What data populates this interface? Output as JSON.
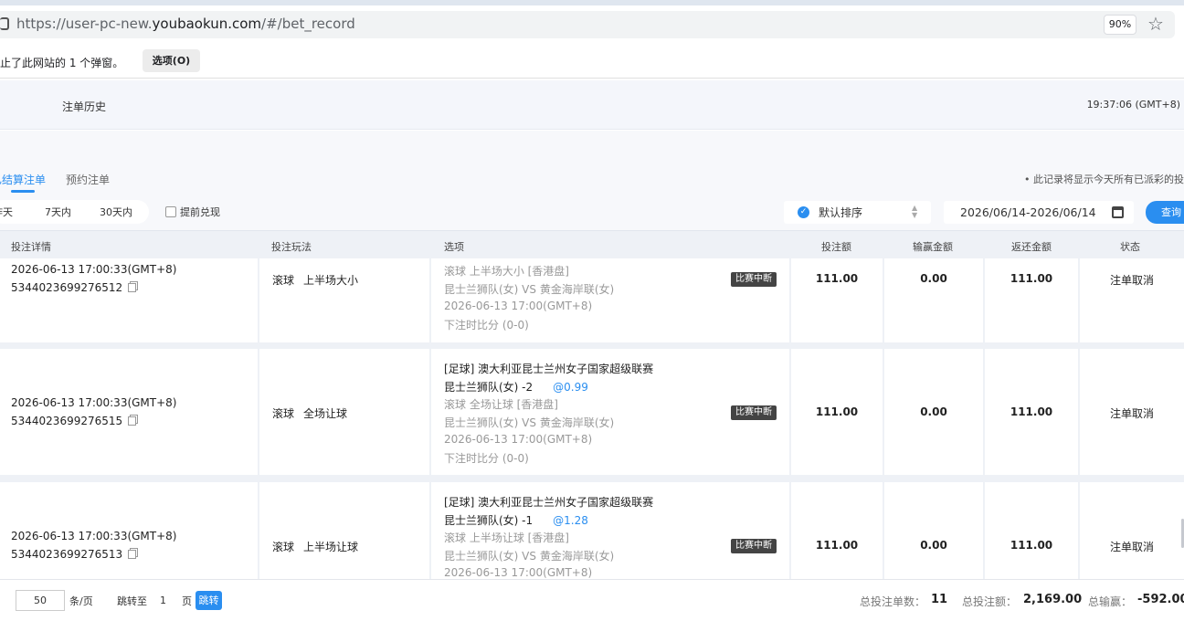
{
  "browser": {
    "url_prefix": "https://user-pc-new.",
    "url_host": "youbaokun.com",
    "url_path": "/#/bet_record",
    "zoom": "90%",
    "popup_text": "止了此网站的 1 个弹窗。",
    "popup_button": "选项(O)"
  },
  "header": {
    "title": "注单历史",
    "clock": "19:37:06 (GMT+8)"
  },
  "tabs": [
    {
      "label": "已结算注单",
      "active": true
    },
    {
      "label": "预约注单",
      "active": false
    }
  ],
  "notice": "• 此记录将显示今天所有已派彩的投",
  "filters": {
    "ranges": [
      "昨天",
      "7天内",
      "30天内"
    ],
    "early_cashout": "提前兑现",
    "sort": "默认排序",
    "date_range": "2026/06/14-2026/06/14",
    "query_button": "查询"
  },
  "columns": [
    "投注详情",
    "投注玩法",
    "选项",
    "投注额",
    "输赢金额",
    "返还金额",
    "状态"
  ],
  "rows": [
    {
      "time": "2026-06-13 17:00:33(GMT+8)",
      "order_id": "5344023699276512",
      "play_type": "滚球",
      "play_name": "上半场大小",
      "league": "",
      "selection": "",
      "odds": "",
      "market": "滚球 上半场大小 [香港盘]",
      "teams": "昆士兰狮队(女) VS 黄金海岸联(女)",
      "match_time": "2026-06-13 17:00(GMT+8)",
      "score": "下注时比分 (0-0)",
      "badge": "比赛中断",
      "stake": "111.00",
      "win_loss": "0.00",
      "returned": "111.00",
      "status": "注单取消"
    },
    {
      "time": "2026-06-13 17:00:33(GMT+8)",
      "order_id": "5344023699276515",
      "play_type": "滚球",
      "play_name": "全场让球",
      "league": "[足球] 澳大利亚昆士兰州女子国家超级联赛",
      "selection": "昆士兰狮队(女) -2",
      "odds": "@0.99",
      "market": "滚球 全场让球 [香港盘]",
      "teams": "昆士兰狮队(女) VS 黄金海岸联(女)",
      "match_time": "2026-06-13 17:00(GMT+8)",
      "score": "下注时比分 (0-0)",
      "badge": "比赛中断",
      "stake": "111.00",
      "win_loss": "0.00",
      "returned": "111.00",
      "status": "注单取消"
    },
    {
      "time": "2026-06-13 17:00:33(GMT+8)",
      "order_id": "5344023699276513",
      "play_type": "滚球",
      "play_name": "上半场让球",
      "league": "[足球] 澳大利亚昆士兰州女子国家超级联赛",
      "selection": "昆士兰狮队(女) -1",
      "odds": "@1.28",
      "market": "滚球 上半场让球 [香港盘]",
      "teams": "昆士兰狮队(女) VS 黄金海岸联(女)",
      "match_time": "2026-06-13 17:00(GMT+8)",
      "score": "",
      "badge": "比赛中断",
      "stake": "111.00",
      "win_loss": "0.00",
      "returned": "111.00",
      "status": "注单取消"
    }
  ],
  "footer": {
    "page_size": "50",
    "per_page": "条/页",
    "jump_to": "跳转至",
    "page_num": "1",
    "page_unit": "页",
    "jump_button": "跳转",
    "total_count_label": "总投注单数：",
    "total_count": "11",
    "total_stake_label": "总投注额：",
    "total_stake": "2,169.00",
    "total_winloss_label": "总输赢：",
    "total_winloss": "-592.00"
  }
}
